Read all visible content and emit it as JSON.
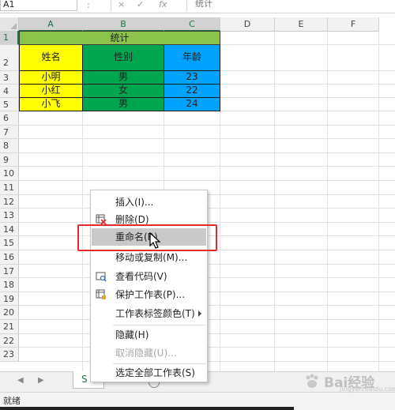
{
  "formula_bar": {
    "name_box": "A1",
    "separator": ":",
    "cancel_icon": "×",
    "confirm_icon": "✓",
    "fx_label": "fx",
    "value": "统计"
  },
  "columns": [
    "A",
    "B",
    "C",
    "D",
    "E",
    "F"
  ],
  "rows": [
    "1",
    "2",
    "3",
    "4",
    "5",
    "6",
    "7",
    "8",
    "9",
    "10",
    "11",
    "12",
    "13",
    "14",
    "15",
    "16",
    "17",
    "18",
    "19",
    "20",
    "21",
    "22",
    "23"
  ],
  "table": {
    "title": "统计",
    "headers": [
      "姓名",
      "性别",
      "年龄"
    ],
    "data": [
      [
        "小明",
        "男",
        "23"
      ],
      [
        "小红",
        "女",
        "22"
      ],
      [
        "小飞",
        "男",
        "24"
      ]
    ],
    "colors": {
      "title": "#8bc34a",
      "name_col": "#ffff00",
      "gender_col": "#00a550",
      "age_col": "#00a2ff"
    }
  },
  "sheet_tab": {
    "label": "S"
  },
  "status": {
    "text": "就绪"
  },
  "context_menu": {
    "items": [
      {
        "label": "插入(I)...",
        "icon": "",
        "disabled": false
      },
      {
        "label": "删除(D)",
        "icon": "delete-sheet-icon",
        "disabled": false
      },
      {
        "label": "重命名(R)",
        "icon": "",
        "disabled": false,
        "highlighted": true
      },
      {
        "label": "移动或复制(M)...",
        "icon": "",
        "disabled": false
      },
      {
        "label": "查看代码(V)",
        "icon": "view-code-icon",
        "disabled": false
      },
      {
        "label": "保护工作表(P)...",
        "icon": "protect-sheet-icon",
        "disabled": false
      },
      {
        "label": "工作表标签颜色(T)",
        "icon": "",
        "disabled": false,
        "submenu": true
      },
      {
        "label": "隐藏(H)",
        "icon": "",
        "disabled": false
      },
      {
        "label": "取消隐藏(U)...",
        "icon": "",
        "disabled": true
      },
      {
        "label": "选定全部工作表(S)",
        "icon": "",
        "disabled": false
      }
    ]
  },
  "watermark": {
    "text": "Bai经验",
    "sub": "jingyan.baidu.com"
  }
}
